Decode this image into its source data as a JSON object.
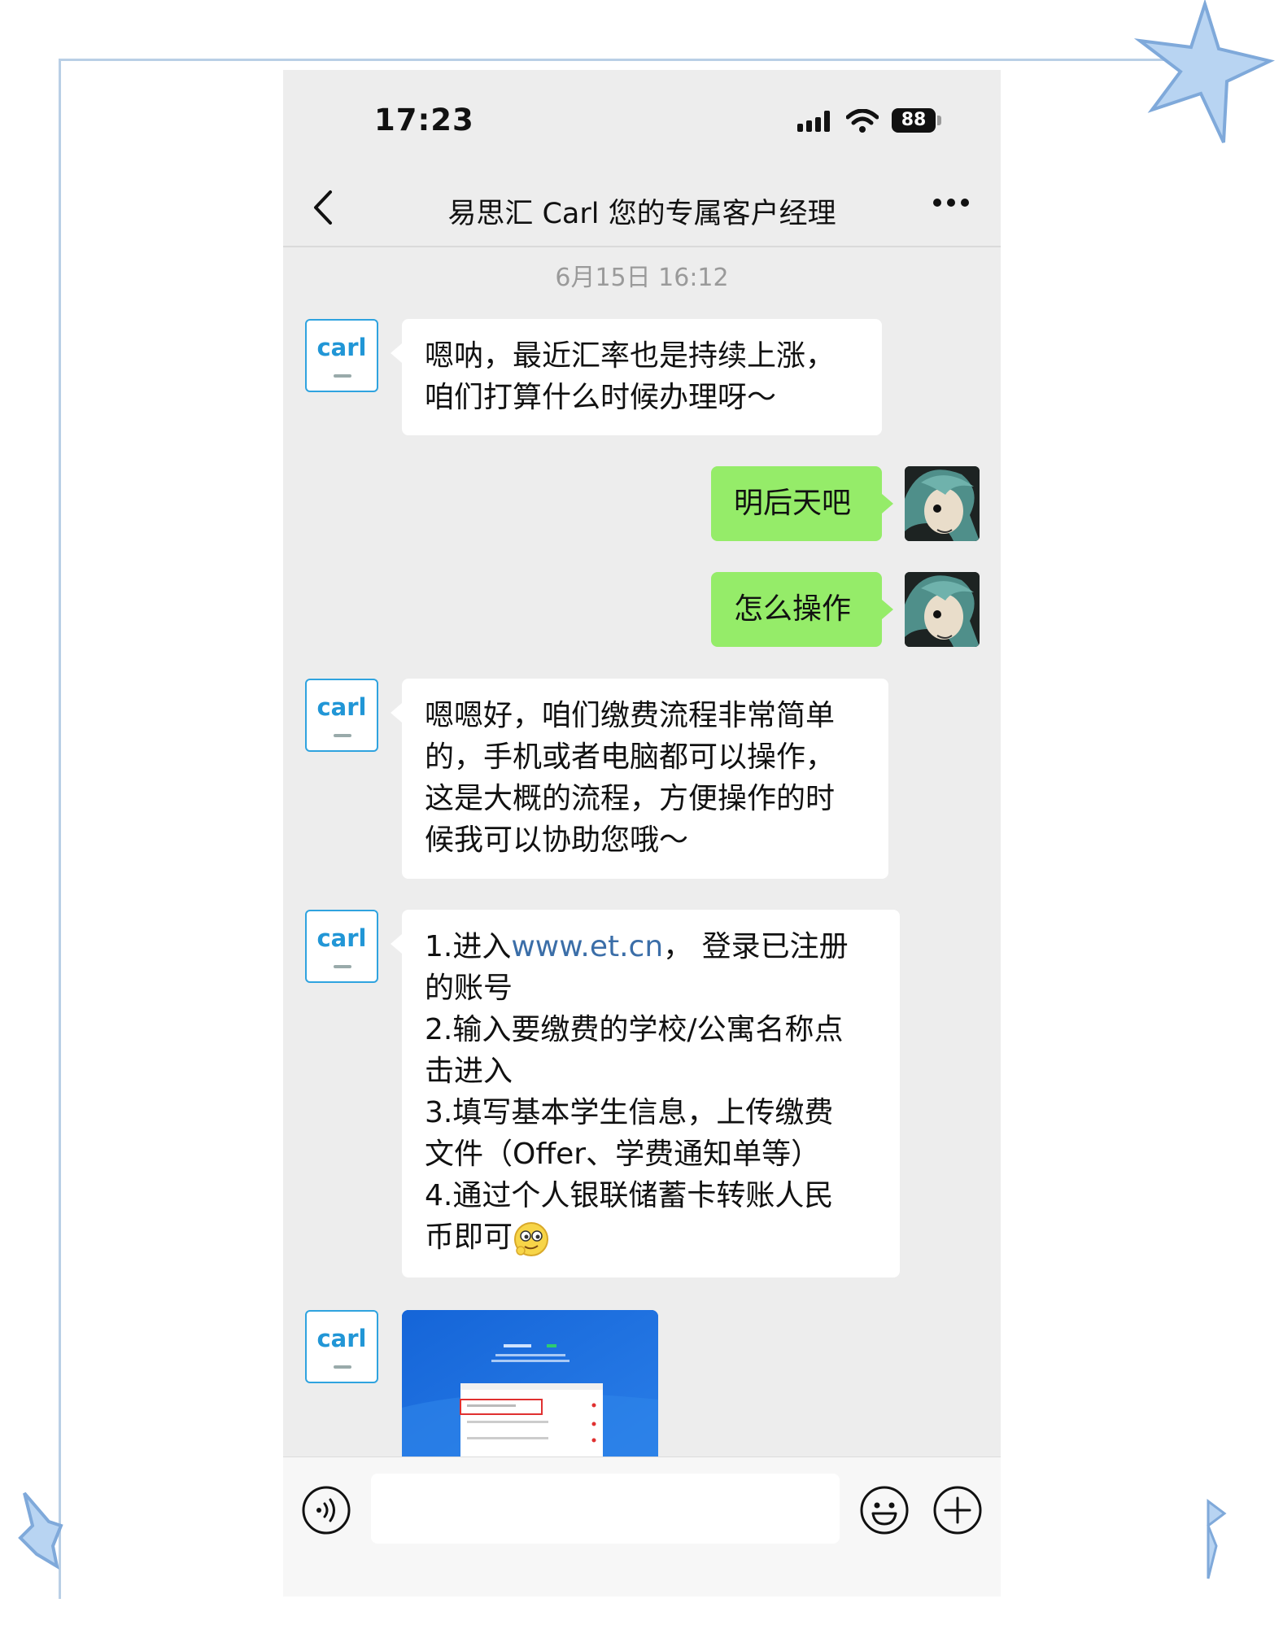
{
  "status_bar": {
    "time": "17:23",
    "battery": "88"
  },
  "nav": {
    "title": "易思汇 Carl 您的专属客户经理"
  },
  "chat": {
    "timestamp": "6月15日 16:12",
    "contact_avatar_text": "carl",
    "messages": {
      "m1_line1": "嗯呐，最近汇率也是持续上涨，",
      "m1_line2": "咱们打算什么时候办理呀～",
      "m2": "明后天吧",
      "m3": "怎么操作",
      "m4_line1": "嗯嗯好，咱们缴费流程非常简单",
      "m4_line2": "的，手机或者电脑都可以操作，",
      "m4_line3": "这是大概的流程，方便操作的时",
      "m4_line4": "候我可以协助您哦～",
      "m5_l1_a": "1.进入",
      "m5_l1_link": "www.et.cn",
      "m5_l1_b": "， 登录已注册",
      "m5_l2": "的账号",
      "m5_l3": "2.输入要缴费的学校/公寓名称点",
      "m5_l4": "击进入",
      "m5_l5": "3.填写基本学生信息，上传缴费",
      "m5_l6": "文件（Offer、学费通知单等）",
      "m5_l7": "4.通过个人银联储蓄卡转账人民",
      "m5_l8": "币即可"
    }
  },
  "icons": {
    "back": "chevron-left-icon",
    "more": "more-dots-icon",
    "voice": "voice-icon",
    "emoji": "emoji-icon",
    "plus": "plus-icon"
  },
  "colors": {
    "outgoing_bubble": "#95ec69",
    "incoming_bubble": "#ffffff",
    "chat_bg": "#ededed",
    "link": "#3b6ea8"
  }
}
